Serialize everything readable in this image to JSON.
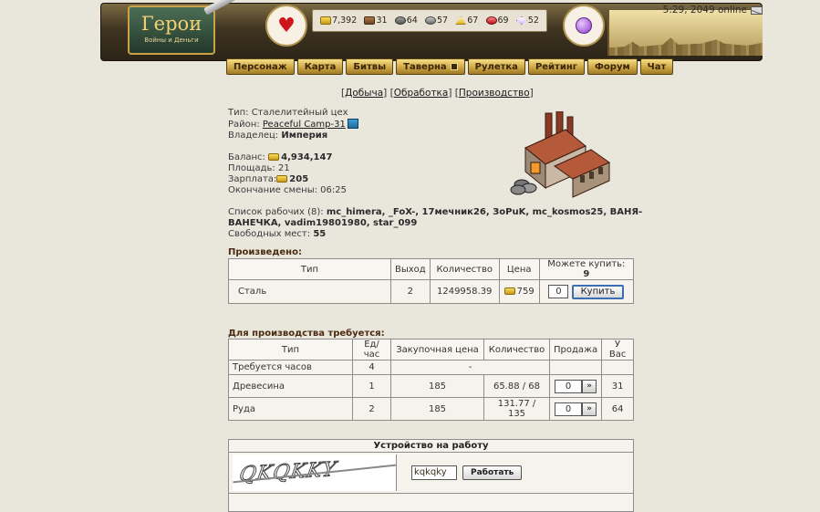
{
  "header": {
    "logo_title": "Герои",
    "logo_subtitle": "Войны и Деньги",
    "resources": [
      {
        "icon": "gold-icon",
        "value": "7,392"
      },
      {
        "icon": "wood-icon",
        "value": "31"
      },
      {
        "icon": "ore-icon",
        "value": "64"
      },
      {
        "icon": "mercury-icon",
        "value": "57"
      },
      {
        "icon": "sulfur-icon",
        "value": "67"
      },
      {
        "icon": "crystal-icon",
        "value": "69"
      },
      {
        "icon": "gem-icon",
        "value": "52"
      }
    ],
    "clock": "5:29, 2049 online",
    "nav": [
      "Персонаж",
      "Карта",
      "Битвы",
      "Таверна",
      "Рулетка",
      "Рейтинг",
      "Форум",
      "Чат"
    ]
  },
  "subnav": {
    "open": "[",
    "close": "]",
    "mining": "Добыча",
    "processing": "Обработка",
    "production": "Производство"
  },
  "info": {
    "type_label": "Тип:",
    "type_value": "Сталелитейный цех",
    "district_label": "Район:",
    "district_value": "Peaceful Camp-31",
    "owner_label": "Владелец:",
    "owner_value": "Империя",
    "balance_label": "Баланс:",
    "balance_value": "4,934,147",
    "area_label": "Площадь:",
    "area_value": "21",
    "salary_label": "Зарплата:",
    "salary_value": "205",
    "shift_label": "Окончание смены:",
    "shift_value": "06:25",
    "workers_label": "Список рабочих (8):",
    "workers_line1": "mc_himera, _FoX-, 17мечник26, ЗоPuK, mc_kosmos25, ВАНЯ-",
    "workers_line2": "ВАНЕЧКА, vadim19801980, star_099",
    "free_label": "Свободных мест:",
    "free_value": "55"
  },
  "produced": {
    "title": "Произведено:",
    "headers": [
      "Тип",
      "Выход",
      "Количество",
      "Цена",
      "Можете купить:"
    ],
    "can_buy": "9",
    "row": {
      "type": "Сталь",
      "output": "2",
      "amount": "1249958.39",
      "price": "759",
      "qty": "0",
      "buy_label": "Купить"
    }
  },
  "required": {
    "title": "Для производства требуется:",
    "headers": [
      "Тип",
      "Ед/час",
      "Закупочная цена",
      "Количество",
      "Продажа",
      "У Вас"
    ],
    "hours_row": {
      "type": "Требуется часов",
      "per_hour": "4",
      "dash": "-"
    },
    "rows": [
      {
        "type": "Древесина",
        "per_hour": "1",
        "buy_price": "185",
        "amount": "65.88 / 68",
        "sell_qty": "0",
        "arrow": "»",
        "have": "31"
      },
      {
        "type": "Руда",
        "per_hour": "2",
        "buy_price": "185",
        "amount": "131.77 / 135",
        "sell_qty": "0",
        "arrow": "»",
        "have": "64"
      }
    ]
  },
  "job": {
    "title": "Устройство на работу",
    "captcha_text": "QKQKKY",
    "code_value": "kqkqky",
    "submit_label": "Работать"
  }
}
